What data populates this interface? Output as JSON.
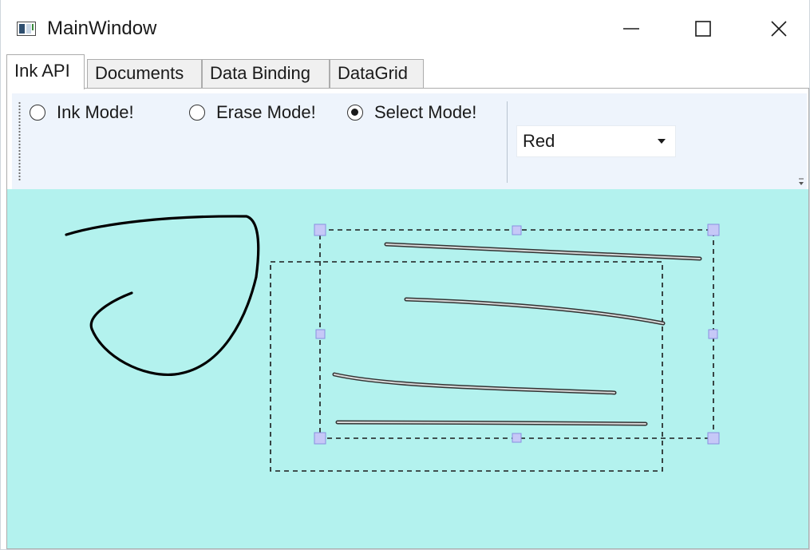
{
  "window": {
    "title": "MainWindow",
    "controls": {
      "minimize": "minimize-icon",
      "maximize": "maximize-icon",
      "close": "close-icon"
    }
  },
  "tabs": [
    {
      "label": "Ink API",
      "selected": true
    },
    {
      "label": "Documents",
      "selected": false
    },
    {
      "label": "Data Binding",
      "selected": false
    },
    {
      "label": "DataGrid",
      "selected": false
    }
  ],
  "toolbar": {
    "modes": [
      {
        "label": "Ink Mode!",
        "checked": false
      },
      {
        "label": "Erase Mode!",
        "checked": false
      },
      {
        "label": "Select Mode!",
        "checked": true
      }
    ],
    "color_combo": {
      "selected": "Red"
    }
  },
  "canvas": {
    "background": "#b3f2ee",
    "stroke_color": "#000000",
    "selection_handle_color": "#c6c8f7",
    "strokes": [
      "curved-ink-stroke",
      "line-stroke-1",
      "line-stroke-2",
      "line-stroke-3",
      "line-stroke-4"
    ],
    "selected_strokes": 4
  }
}
